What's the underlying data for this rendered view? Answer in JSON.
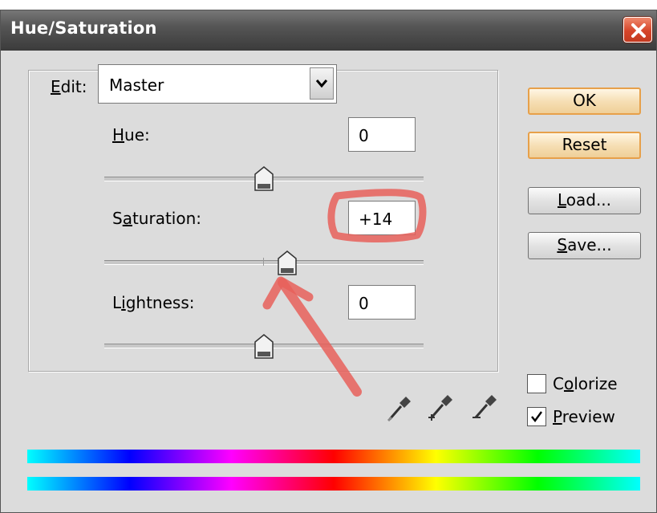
{
  "dialog": {
    "title": "Hue/Saturation",
    "edit_label": "Edit:",
    "edit_value": "Master",
    "params": [
      {
        "label": "Hue:",
        "value": "0",
        "slider_value": 0
      },
      {
        "label": "Saturation:",
        "value": "+14",
        "slider_value": 14
      },
      {
        "label": "Lightness:",
        "value": "0",
        "slider_value": 0
      }
    ],
    "buttons": {
      "ok": "OK",
      "reset": "Reset",
      "load": "Load...",
      "save": "Save..."
    },
    "colorize": {
      "label": "Colorize",
      "checked": false
    },
    "preview": {
      "label": "Preview",
      "checked": true
    },
    "icons": [
      "eyedropper-icon",
      "eyedropper-plus-icon",
      "eyedropper-minus-icon",
      "close-icon",
      "chevron-down-icon"
    ],
    "annotation_color": "#e8605a"
  }
}
